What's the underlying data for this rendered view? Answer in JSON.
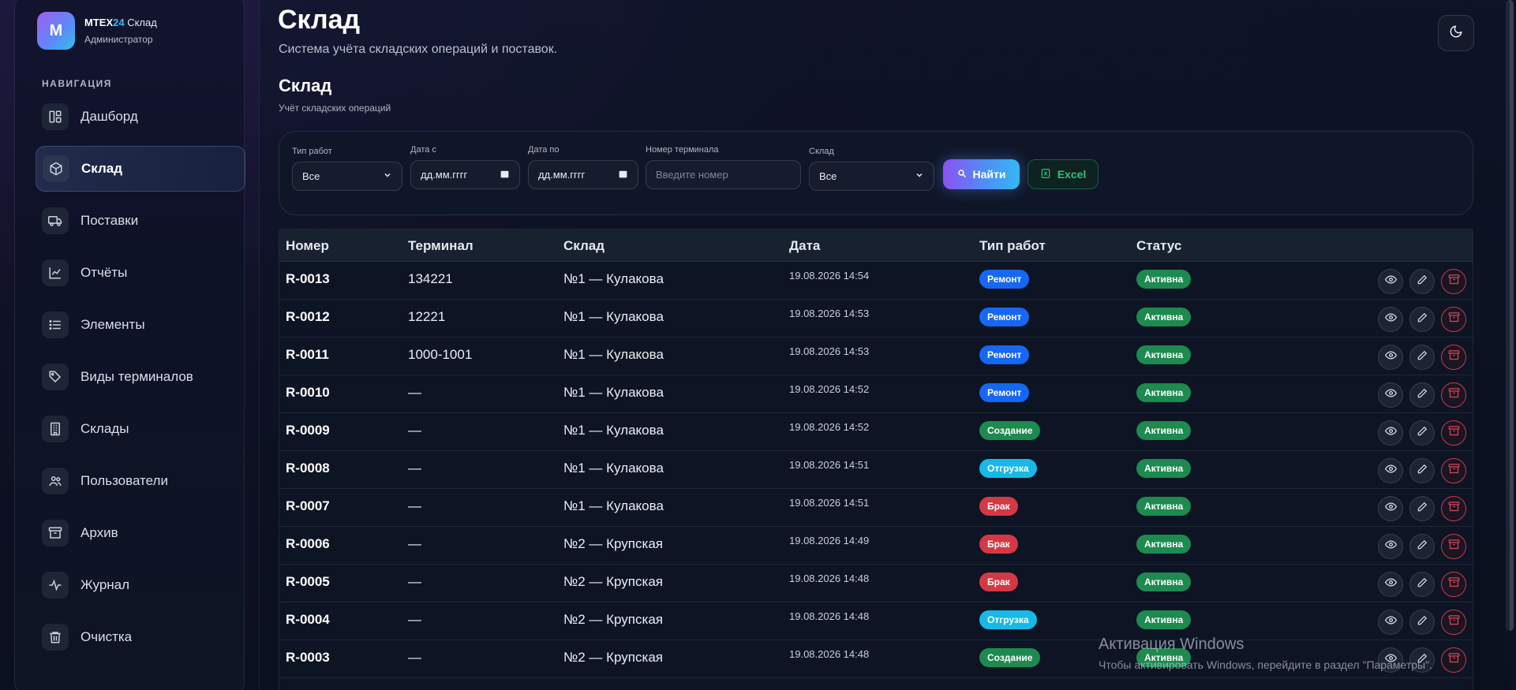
{
  "brand": {
    "logo_letter": "M",
    "name_part1": "MTEX",
    "name_part2": "24",
    "name_part3": " Склад",
    "role": "Администратор",
    "accent_color": "#3bb7f5"
  },
  "nav": {
    "heading": "НАВИГАЦИЯ",
    "items": [
      {
        "label": "Дашборд",
        "icon": "dashboard-icon",
        "active": false
      },
      {
        "label": "Склад",
        "icon": "box-icon",
        "active": true
      },
      {
        "label": "Поставки",
        "icon": "truck-icon",
        "active": false
      },
      {
        "label": "Отчёты",
        "icon": "chart-icon",
        "active": false
      },
      {
        "label": "Элементы",
        "icon": "list-icon",
        "active": false
      },
      {
        "label": "Виды терминалов",
        "icon": "tag-icon",
        "active": false
      },
      {
        "label": "Склады",
        "icon": "building-icon",
        "active": false
      },
      {
        "label": "Пользователи",
        "icon": "users-icon",
        "active": false
      },
      {
        "label": "Архив",
        "icon": "archive-icon",
        "active": false
      },
      {
        "label": "Журнал",
        "icon": "activity-icon",
        "active": false
      },
      {
        "label": "Очистка",
        "icon": "trash-icon",
        "active": false
      }
    ]
  },
  "header": {
    "title": "Склад",
    "subtitle": "Система учёта складских операций и поставок.",
    "theme_toggle": "moon-icon"
  },
  "section": {
    "title": "Склад",
    "subtitle": "Учёт складских операций"
  },
  "filters": {
    "work_type": {
      "label": "Тип работ",
      "value": "Все"
    },
    "date_from": {
      "label": "Дата с",
      "value": "дд.мм.гггг"
    },
    "date_to": {
      "label": "Дата по",
      "value": "дд.мм.гггг"
    },
    "terminal": {
      "label": "Номер терминала",
      "placeholder": "Введите номер",
      "value": ""
    },
    "warehouse": {
      "label": "Склад",
      "value": "Все"
    },
    "search_label": "Найти",
    "excel_label": "Excel"
  },
  "table": {
    "columns": [
      "Номер",
      "Терминал",
      "Склад",
      "Дата",
      "Тип работ",
      "Статус"
    ],
    "rows": [
      {
        "num": "R-0013",
        "terminal": "134221",
        "warehouse": "№1 — Кулакова",
        "date": "19.08.2026 14:54",
        "type": "Ремонт",
        "status": "Активна"
      },
      {
        "num": "R-0012",
        "terminal": "12221",
        "warehouse": "№1 — Кулакова",
        "date": "19.08.2026 14:53",
        "type": "Ремонт",
        "status": "Активна"
      },
      {
        "num": "R-0011",
        "terminal": "1000-1001",
        "warehouse": "№1 — Кулакова",
        "date": "19.08.2026 14:53",
        "type": "Ремонт",
        "status": "Активна"
      },
      {
        "num": "R-0010",
        "terminal": "—",
        "warehouse": "№1 — Кулакова",
        "date": "19.08.2026 14:52",
        "type": "Ремонт",
        "status": "Активна"
      },
      {
        "num": "R-0009",
        "terminal": "—",
        "warehouse": "№1 — Кулакова",
        "date": "19.08.2026 14:52",
        "type": "Создание",
        "status": "Активна"
      },
      {
        "num": "R-0008",
        "terminal": "—",
        "warehouse": "№1 — Кулакова",
        "date": "19.08.2026 14:51",
        "type": "Отгрузка",
        "status": "Активна"
      },
      {
        "num": "R-0007",
        "terminal": "—",
        "warehouse": "№1 — Кулакова",
        "date": "19.08.2026 14:51",
        "type": "Брак",
        "status": "Активна"
      },
      {
        "num": "R-0006",
        "terminal": "—",
        "warehouse": "№2 — Крупская",
        "date": "19.08.2026 14:49",
        "type": "Брак",
        "status": "Активна"
      },
      {
        "num": "R-0005",
        "terminal": "—",
        "warehouse": "№2 — Крупская",
        "date": "19.08.2026 14:48",
        "type": "Брак",
        "status": "Активна"
      },
      {
        "num": "R-0004",
        "terminal": "—",
        "warehouse": "№2 — Крупская",
        "date": "19.08.2026 14:48",
        "type": "Отгрузка",
        "status": "Активна"
      },
      {
        "num": "R-0003",
        "terminal": "—",
        "warehouse": "№2 — Крупская",
        "date": "19.08.2026 14:48",
        "type": "Создание",
        "status": "Активна"
      }
    ],
    "type_colors": {
      "Ремонт": "#1667f2",
      "Создание": "#1d8a4f",
      "Отгрузка": "#17b9e6",
      "Брак": "#d43845"
    },
    "status_color": "#1d8a4f",
    "actions": [
      "eye-icon",
      "pencil-icon",
      "archive-icon"
    ]
  },
  "watermark": {
    "title": "Активация Windows",
    "text": "Чтобы активировать Windows, перейдите в раздел \"Параметры\"."
  }
}
